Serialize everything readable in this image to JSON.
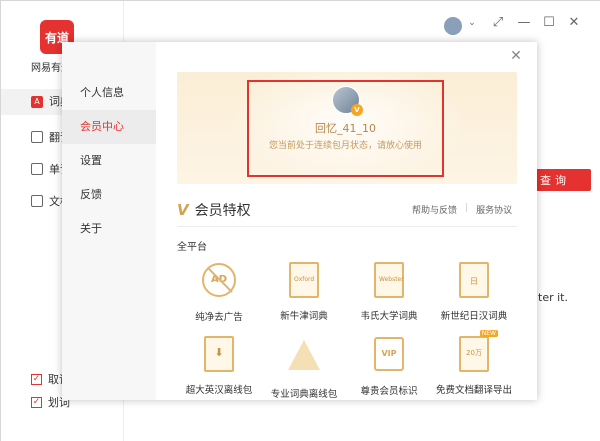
{
  "app": {
    "logo_text": "有道",
    "name": "网易有道",
    "nav": [
      {
        "label": "词典",
        "icon": "dictionary-icon"
      },
      {
        "label": "翻译",
        "icon": "translate-icon"
      },
      {
        "label": "单词本",
        "icon": "wordbook-icon"
      },
      {
        "label": "文档",
        "icon": "document-icon"
      }
    ],
    "checks": [
      {
        "label": "取词"
      },
      {
        "label": "划词"
      }
    ],
    "search_button": "查询",
    "bg_text": "ter it."
  },
  "window_controls": {
    "minimize": "—",
    "restore": "⤢",
    "maximize": "☐",
    "close": "✕"
  },
  "modal": {
    "close": "✕",
    "side_menu": [
      {
        "label": "个人信息",
        "active": false
      },
      {
        "label": "会员中心",
        "active": true
      },
      {
        "label": "设置",
        "active": false
      },
      {
        "label": "反馈",
        "active": false
      },
      {
        "label": "关于",
        "active": false
      }
    ],
    "user": {
      "name": "回忆_41_10",
      "status": "您当前处于连续包月状态，请放心使用",
      "badge": "V"
    },
    "vip_section": {
      "mark": "V",
      "title": "会员特权",
      "help_link": "帮助与反馈",
      "agreement_link": "服务协议",
      "platform": "全平台"
    },
    "features": [
      {
        "label": "纯净去广告",
        "icon": "no-ad-icon",
        "glyph": "AD"
      },
      {
        "label": "新牛津词典",
        "icon": "oxford-dictionary-icon",
        "glyph": "Oxford"
      },
      {
        "label": "韦氏大学词典",
        "icon": "webster-dictionary-icon",
        "glyph": "Webster"
      },
      {
        "label": "新世纪日汉词典",
        "icon": "japanese-dictionary-icon",
        "glyph": "日"
      },
      {
        "label": "超大英汉离线包",
        "icon": "offline-package-icon",
        "glyph": "⬇"
      },
      {
        "label": "专业词典离线包",
        "icon": "professional-dictionary-icon",
        "glyph": ""
      },
      {
        "label": "尊贵会员标识",
        "icon": "vip-badge-icon",
        "glyph": "VIP"
      },
      {
        "label": "免费文档翻译导出",
        "icon": "document-translate-icon",
        "glyph": "20万",
        "tag": "NEW"
      }
    ]
  }
}
